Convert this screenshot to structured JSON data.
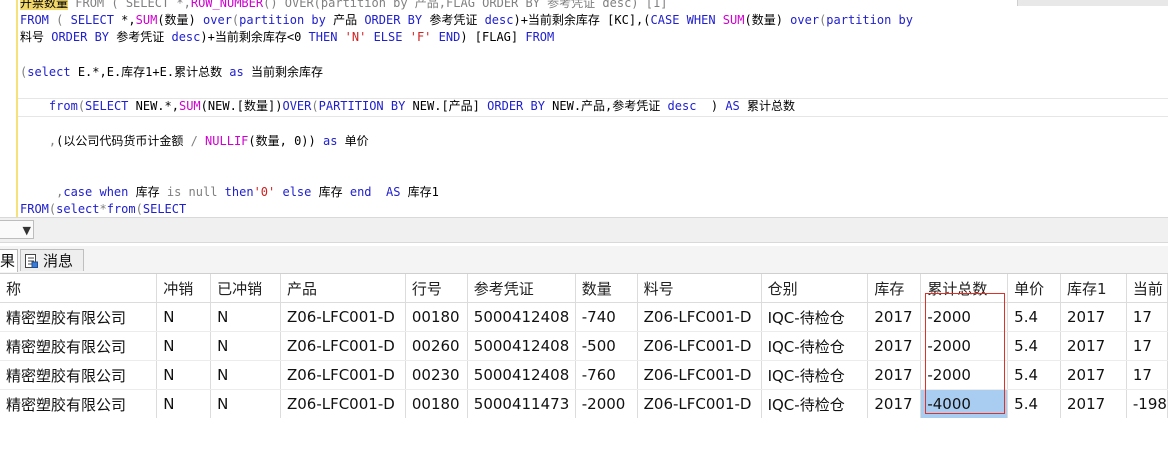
{
  "editor": {
    "lines": [
      {
        "parts": [
          {
            "t": "开票数量",
            "c": "hl"
          },
          {
            "t": " FROM ( SELECT *,",
            "c": "gr"
          },
          {
            "t": "ROW_NUMBER",
            "c": "fn"
          },
          {
            "t": "() OVER(partition by 产品,FLAG ORDER BY 参考凭证 desc) [1]",
            "c": "gr"
          }
        ]
      },
      {
        "parts": [
          {
            "t": "FROM",
            "c": "kw"
          },
          {
            "t": " ( ",
            "c": "gr"
          },
          {
            "t": "SELECT",
            "c": "kw"
          },
          {
            "t": " *,",
            "c": ""
          },
          {
            "t": "SUM",
            "c": "fn"
          },
          {
            "t": "(数量) ",
            "c": ""
          },
          {
            "t": "over",
            "c": "kw"
          },
          {
            "t": "(",
            "c": "gr"
          },
          {
            "t": "partition",
            "c": "kw"
          },
          {
            "t": " by ",
            "c": "kw"
          },
          {
            "t": "产品 ",
            "c": ""
          },
          {
            "t": "ORDER BY",
            "c": "kw"
          },
          {
            "t": " 参考凭证 ",
            "c": ""
          },
          {
            "t": "desc",
            "c": "kw"
          },
          {
            "t": ")+当前剩余库存 [KC],(",
            "c": ""
          },
          {
            "t": "CASE WHEN",
            "c": "kw"
          },
          {
            "t": " ",
            "c": ""
          },
          {
            "t": "SUM",
            "c": "fn"
          },
          {
            "t": "(数量) ",
            "c": ""
          },
          {
            "t": "over",
            "c": "kw"
          },
          {
            "t": "(",
            "c": "gr"
          },
          {
            "t": "partition by",
            "c": "kw"
          }
        ]
      },
      {
        "parts": [
          {
            "t": "料号 ",
            "c": ""
          },
          {
            "t": "ORDER BY",
            "c": "kw"
          },
          {
            "t": " 参考凭证 ",
            "c": ""
          },
          {
            "t": "desc",
            "c": "kw"
          },
          {
            "t": ")+当前剩余库存<0 ",
            "c": ""
          },
          {
            "t": "THEN",
            "c": "kw"
          },
          {
            "t": " ",
            "c": ""
          },
          {
            "t": "'N'",
            "c": "str"
          },
          {
            "t": " ",
            "c": ""
          },
          {
            "t": "ELSE",
            "c": "kw"
          },
          {
            "t": " ",
            "c": ""
          },
          {
            "t": "'F'",
            "c": "str"
          },
          {
            "t": " ",
            "c": ""
          },
          {
            "t": "END",
            "c": "kw"
          },
          {
            "t": ") [FLAG] ",
            "c": ""
          },
          {
            "t": "FROM",
            "c": "kw"
          }
        ]
      },
      {
        "parts": []
      },
      {
        "parts": [
          {
            "t": "(",
            "c": "gr"
          },
          {
            "t": "select",
            "c": "kw"
          },
          {
            "t": " E.*,E.库存1+E.累计总数 ",
            "c": ""
          },
          {
            "t": "as",
            "c": "kw"
          },
          {
            "t": " 当前剩余库存",
            "c": ""
          }
        ]
      },
      {
        "parts": []
      },
      {
        "parts": [
          {
            "t": "    ",
            "c": ""
          },
          {
            "t": "from",
            "c": "kw"
          },
          {
            "t": "(",
            "c": "gr"
          },
          {
            "t": "SELECT",
            "c": "kw"
          },
          {
            "t": " NEW.*,",
            "c": ""
          },
          {
            "t": "SUM",
            "c": "fn"
          },
          {
            "t": "(NEW.[数量])",
            "c": ""
          },
          {
            "t": "OVER",
            "c": "kw"
          },
          {
            "t": "(",
            "c": "gr"
          },
          {
            "t": "PARTITION BY",
            "c": "kw"
          },
          {
            "t": " NEW.[产品] ",
            "c": ""
          },
          {
            "t": "ORDER BY",
            "c": "kw"
          },
          {
            "t": " NEW.产品,参考凭证 ",
            "c": ""
          },
          {
            "t": "desc",
            "c": "kw"
          },
          {
            "t": "  ) ",
            "c": ""
          },
          {
            "t": "AS",
            "c": "kw"
          },
          {
            "t": " 累计总数",
            "c": ""
          }
        ]
      },
      {
        "parts": []
      },
      {
        "parts": [
          {
            "t": "    ,",
            "c": "gr"
          },
          {
            "t": "(以公司代码货币计金额 ",
            "c": ""
          },
          {
            "t": "/",
            "c": "gr"
          },
          {
            "t": " ",
            "c": ""
          },
          {
            "t": "NULLIF",
            "c": "fn"
          },
          {
            "t": "(数量, 0)) ",
            "c": ""
          },
          {
            "t": "as",
            "c": "kw"
          },
          {
            "t": " 单价",
            "c": ""
          }
        ]
      },
      {
        "parts": []
      },
      {
        "parts": []
      },
      {
        "parts": [
          {
            "t": "     ,",
            "c": "gr"
          },
          {
            "t": "case when",
            "c": "kw"
          },
          {
            "t": " 库存 ",
            "c": ""
          },
          {
            "t": "is null",
            "c": "gr"
          },
          {
            "t": " ",
            "c": ""
          },
          {
            "t": "then",
            "c": "kw"
          },
          {
            "t": "'0'",
            "c": "str"
          },
          {
            "t": " ",
            "c": ""
          },
          {
            "t": "else",
            "c": "kw"
          },
          {
            "t": " 库存 ",
            "c": ""
          },
          {
            "t": "end",
            "c": "kw"
          },
          {
            "t": "  ",
            "c": ""
          },
          {
            "t": "AS",
            "c": "kw"
          },
          {
            "t": " 库存1",
            "c": ""
          }
        ]
      },
      {
        "parts": [
          {
            "t": "FROM",
            "c": "kw"
          },
          {
            "t": "(",
            "c": "gr"
          },
          {
            "t": "select",
            "c": "kw"
          },
          {
            "t": "*",
            "c": "gr"
          },
          {
            "t": "from",
            "c": "kw"
          },
          {
            "t": "(",
            "c": "gr"
          },
          {
            "t": "SELECT",
            "c": "kw"
          }
        ]
      }
    ]
  },
  "zoom": {
    "arrow": "▼"
  },
  "tabs": {
    "results_label": "果",
    "messages_label": "消息"
  },
  "grid": {
    "columns": [
      "称",
      "冲销",
      "已冲销",
      "产品",
      "行号",
      "参考凭证",
      "数量",
      "料号",
      "仓别",
      "库存",
      "累计总数",
      "单价",
      "库存1",
      "当前"
    ],
    "rows": [
      [
        "精密塑胶有限公司",
        "N",
        "N",
        "Z06-LFC001-D",
        "00180",
        "5000412408",
        "-740",
        "Z06-LFC001-D",
        "IQC-待检仓",
        "2017",
        "-2000",
        "5.4",
        "2017",
        "17"
      ],
      [
        "精密塑胶有限公司",
        "N",
        "N",
        "Z06-LFC001-D",
        "00260",
        "5000412408",
        "-500",
        "Z06-LFC001-D",
        "IQC-待检仓",
        "2017",
        "-2000",
        "5.4",
        "2017",
        "17"
      ],
      [
        "精密塑胶有限公司",
        "N",
        "N",
        "Z06-LFC001-D",
        "00230",
        "5000412408",
        "-760",
        "Z06-LFC001-D",
        "IQC-待检仓",
        "2017",
        "-2000",
        "5.4",
        "2017",
        "17"
      ],
      [
        "精密塑胶有限公司",
        "N",
        "N",
        "Z06-LFC001-D",
        "00180",
        "5000411473",
        "-2000",
        "Z06-LFC001-D",
        "IQC-待检仓",
        "2017",
        "-4000",
        "5.4",
        "2017",
        "-198"
      ]
    ]
  },
  "colors": {
    "selection": "#a9cdf0",
    "highlight_box": "#e0302a",
    "keyword": "#2020d0",
    "function": "#d000d0",
    "string": "#d02020"
  }
}
